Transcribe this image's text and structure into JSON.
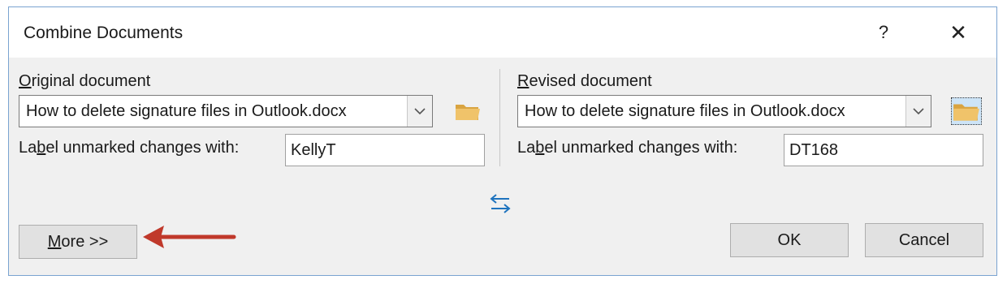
{
  "dialog": {
    "title": "Combine Documents",
    "help_glyph": "?",
    "close_glyph": "✕"
  },
  "original": {
    "heading_u": "O",
    "heading_rest": "riginal document",
    "file": "How to delete signature files in Outlook.docx",
    "label_pre": "La",
    "label_u": "b",
    "label_post": "el unmarked changes with:",
    "label_value": "KellyT"
  },
  "revised": {
    "heading_u": "R",
    "heading_rest": "evised document",
    "file": "How to delete signature files in Outlook.docx",
    "label_pre": "La",
    "label_u": "b",
    "label_post": "el unmarked changes with:",
    "label_value": "DT168"
  },
  "buttons": {
    "more_u": "M",
    "more_rest": "ore >>",
    "ok": "OK",
    "cancel": "Cancel"
  },
  "icons": {
    "folder": "folder-open-icon",
    "swap": "swap-icon",
    "annotation": "red-arrow-annotation"
  },
  "colors": {
    "annotation_arrow": "#c0392b",
    "folder": "#e8b85a",
    "swap": "#1e73be",
    "dialog_border": "#7aa3d1"
  }
}
